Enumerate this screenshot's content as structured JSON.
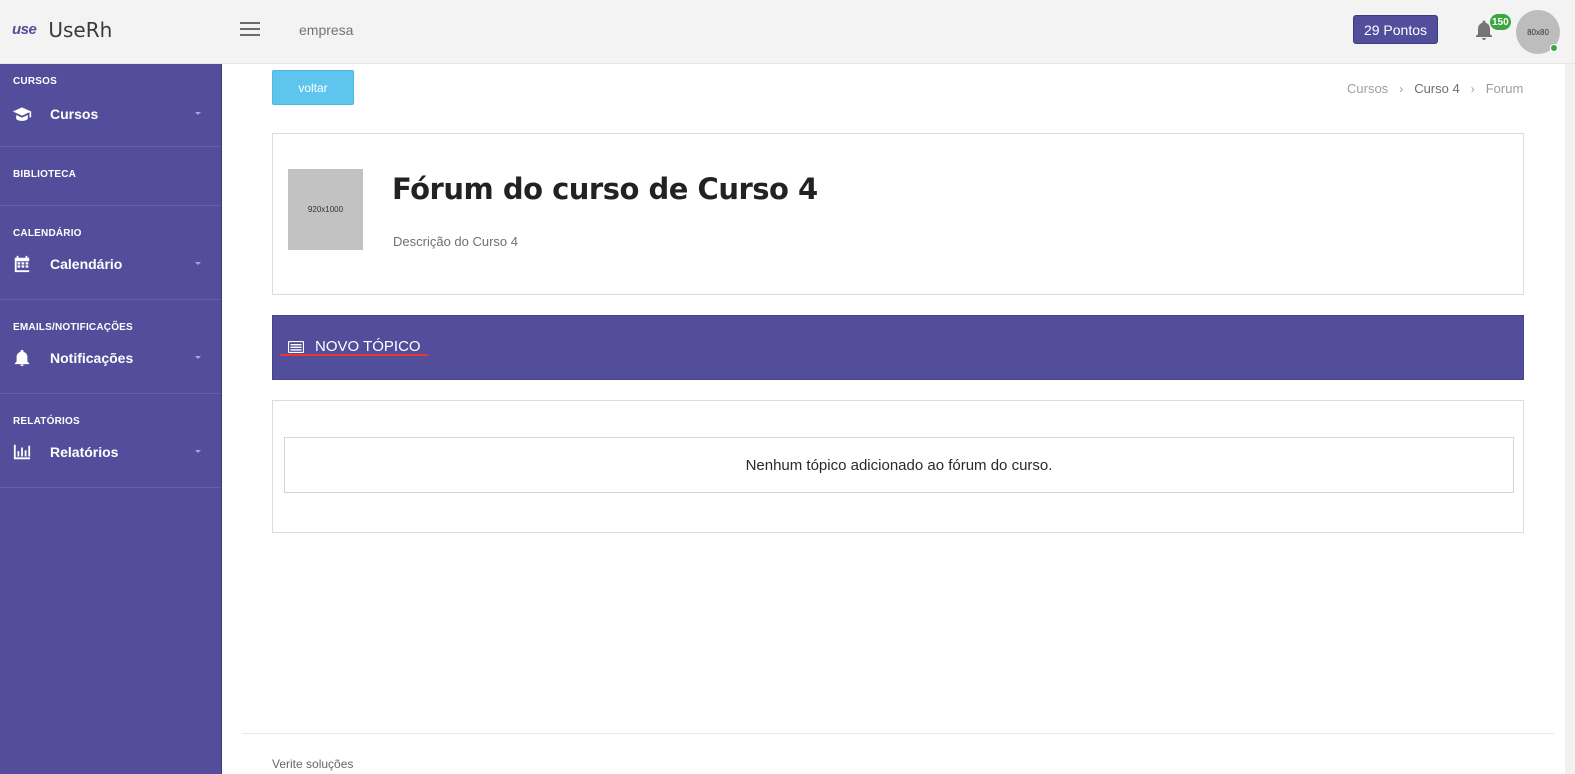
{
  "header": {
    "logo_mark": "use",
    "logo_text": "UseRh",
    "company": "empresa",
    "points": "29 Pontos",
    "notification_count": "150",
    "avatar_text": "80x80"
  },
  "sidebar": {
    "sections": [
      {
        "title": "CURSOS",
        "item": "Cursos"
      },
      {
        "title": "BIBLIOTECA"
      },
      {
        "title": "CALENDÁRIO",
        "item": "Calendário"
      },
      {
        "title": "EMAILS/NOTIFICAÇÕES",
        "item": "Notificações"
      },
      {
        "title": "RELATÓRIOS",
        "item": "Relatórios"
      }
    ]
  },
  "main": {
    "back_label": "voltar",
    "breadcrumb": [
      "Cursos",
      "Curso 4",
      "Forum"
    ],
    "course_image_text": "920x1000",
    "course_title": "Fórum do curso de Curso 4",
    "course_description": "Descrição do Curso 4",
    "new_topic_label": "NOVO TÓPICO",
    "empty_message": "Nenhum tópico adicionado ao fórum do curso."
  },
  "footer": {
    "text": "Verite soluções"
  },
  "colors": {
    "primary": "#534e9b",
    "accent": "#5ec6ee",
    "success": "#3ba540",
    "underline": "#e53935"
  }
}
